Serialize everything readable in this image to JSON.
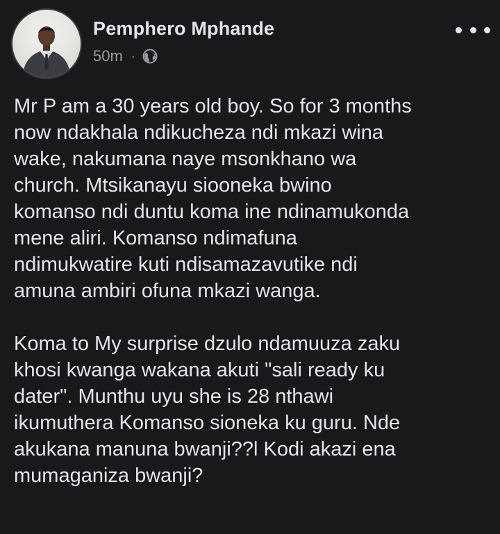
{
  "post": {
    "author": "Pemphero Mphande",
    "time": "50m",
    "separator": "·",
    "privacy_icon": "globe-icon",
    "more_icon": "more-options-icon",
    "paragraphs": [
      {
        "lines": [
          "Mr P am a 30 years old boy. So for 3 months",
          "now ndakhala ndikucheza ndi mkazi wina",
          "wake, nakumana naye msonkhano wa",
          "church. Mtsikanayu siooneka bwino",
          "komanso ndi duntu koma ine ndinamukonda",
          "mene aliri. Komanso ndimafuna",
          "ndimukwatire kuti ndisamazavutike ndi",
          "amuna ambiri ofuna mkazi wanga."
        ]
      },
      {
        "lines": [
          "Koma to My surprise dzulo ndamuuza zaku",
          "khosi kwanga wakana akuti \"sali ready ku",
          "dater\". Munthu uyu she is 28 nthawi",
          "ikumuthera Komanso sioneka ku guru. Nde",
          "akukana manuna bwanji??l Kodi akazi ena",
          "mumaganiza bwanji?"
        ]
      }
    ]
  },
  "colors": {
    "background": "#18191a",
    "primary_text": "#e4e6eb",
    "secondary_text": "#9a9ca1"
  }
}
